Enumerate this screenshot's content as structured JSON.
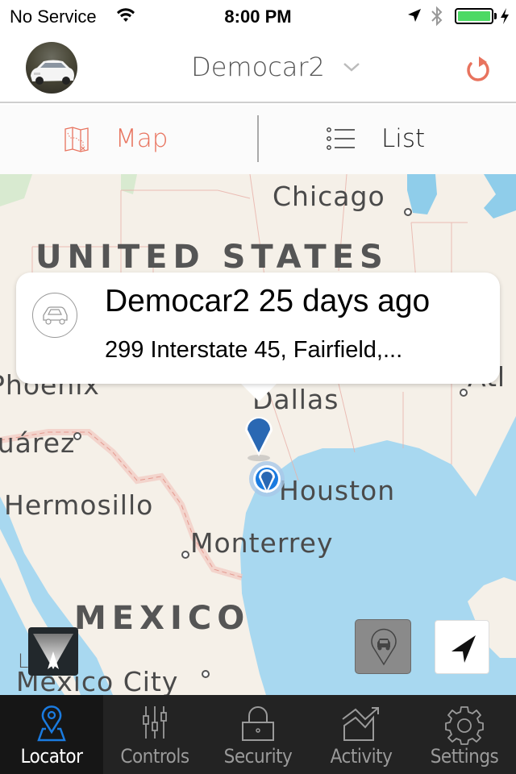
{
  "status_bar": {
    "carrier": "No Service",
    "time": "8:00 PM",
    "battery_level": 1.0,
    "battery_color": "#4cd964",
    "icons": [
      "wifi-icon",
      "location-arrow-icon",
      "bluetooth-icon",
      "battery-icon",
      "charging-bolt-icon"
    ]
  },
  "header": {
    "vehicle_name": "Democar2",
    "avatar_alt": "vehicle-photo",
    "refresh_icon": "refresh-icon",
    "accent_color": "#e8735e"
  },
  "segments": {
    "map_label": "Map",
    "list_label": "List",
    "selected": "Map"
  },
  "map": {
    "labels": {
      "chicago": "Chicago",
      "united_states": "UNITED STATES",
      "phoenix": "Phoenix",
      "dallas": "Dallas",
      "atlanta": "Atl",
      "juarez": "Juárez",
      "houston": "Houston",
      "hermosillo": "Hermosillo",
      "monterrey": "Monterrey",
      "mexico": "MEXICO",
      "mexico_city": "Mexico City",
      "legal": "Legal"
    },
    "callout": {
      "title": "Democar2 25 days ago",
      "address": "299 Interstate 45, Fairfield,..."
    }
  },
  "tab_bar": {
    "tabs": [
      {
        "label": "Locator",
        "icon": "locator-pin-icon",
        "active": true
      },
      {
        "label": "Controls",
        "icon": "sliders-icon",
        "active": false
      },
      {
        "label": "Security",
        "icon": "lock-icon",
        "active": false
      },
      {
        "label": "Activity",
        "icon": "activity-chart-icon",
        "active": false
      },
      {
        "label": "Settings",
        "icon": "gear-icon",
        "active": false
      }
    ],
    "active_color": "#1a7be0"
  }
}
